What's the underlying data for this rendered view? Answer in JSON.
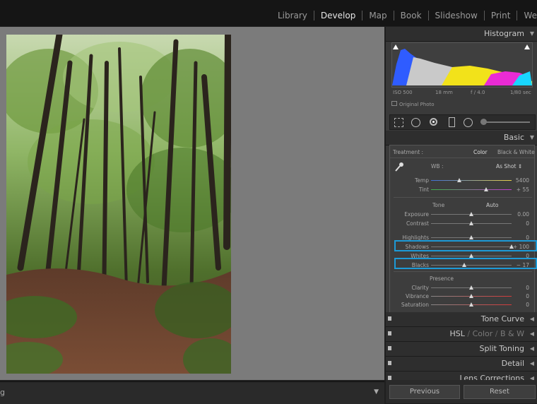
{
  "modules": [
    {
      "label": "Library"
    },
    {
      "label": "Develop"
    },
    {
      "label": "Map"
    },
    {
      "label": "Book"
    },
    {
      "label": "Slideshow"
    },
    {
      "label": "Print"
    },
    {
      "label": "We"
    }
  ],
  "filmstrip": {
    "label": "g"
  },
  "histogram": {
    "title": "Histogram",
    "iso": "ISO 500",
    "focal": "18 mm",
    "aperture": "f / 4.0",
    "shutter": "1/80 sec",
    "original_photo": "Original Photo"
  },
  "basic": {
    "title": "Basic",
    "treatment_label": "Treatment :",
    "treatment_color": "Color",
    "treatment_bw": "Black & White",
    "wb_label": "WB :",
    "wb_value": "As Shot",
    "tone_label": "Tone",
    "auto_label": "Auto",
    "presence_label": "Presence",
    "sliders": {
      "temp": {
        "label": "Temp",
        "value": "5400",
        "pos": 0.35
      },
      "tint": {
        "label": "Tint",
        "value": "+ 55",
        "pos": 0.68
      },
      "exposure": {
        "label": "Exposure",
        "value": "0.00",
        "pos": 0.5
      },
      "contrast": {
        "label": "Contrast",
        "value": "0",
        "pos": 0.5
      },
      "highlights": {
        "label": "Highlights",
        "value": "0",
        "pos": 0.5
      },
      "shadows": {
        "label": "Shadows",
        "value": "+ 100",
        "pos": 1.0
      },
      "whites": {
        "label": "Whites",
        "value": "0",
        "pos": 0.5
      },
      "blacks": {
        "label": "Blacks",
        "value": "− 17",
        "pos": 0.415
      },
      "clarity": {
        "label": "Clarity",
        "value": "0",
        "pos": 0.5
      },
      "vibrance": {
        "label": "Vibrance",
        "value": "0",
        "pos": 0.5
      },
      "saturation": {
        "label": "Saturation",
        "value": "0",
        "pos": 0.5
      }
    }
  },
  "panels": {
    "tone_curve": "Tone Curve",
    "hsl": "HSL",
    "color": "Color",
    "bw": "B & W",
    "split_toning": "Split Toning",
    "detail": "Detail",
    "lens_corrections": "Lens Corrections"
  },
  "buttons": {
    "previous": "Previous",
    "reset": "Reset"
  },
  "colors": {
    "highlight": "#1d9ad6",
    "accent_active": "#e6e6e6"
  }
}
